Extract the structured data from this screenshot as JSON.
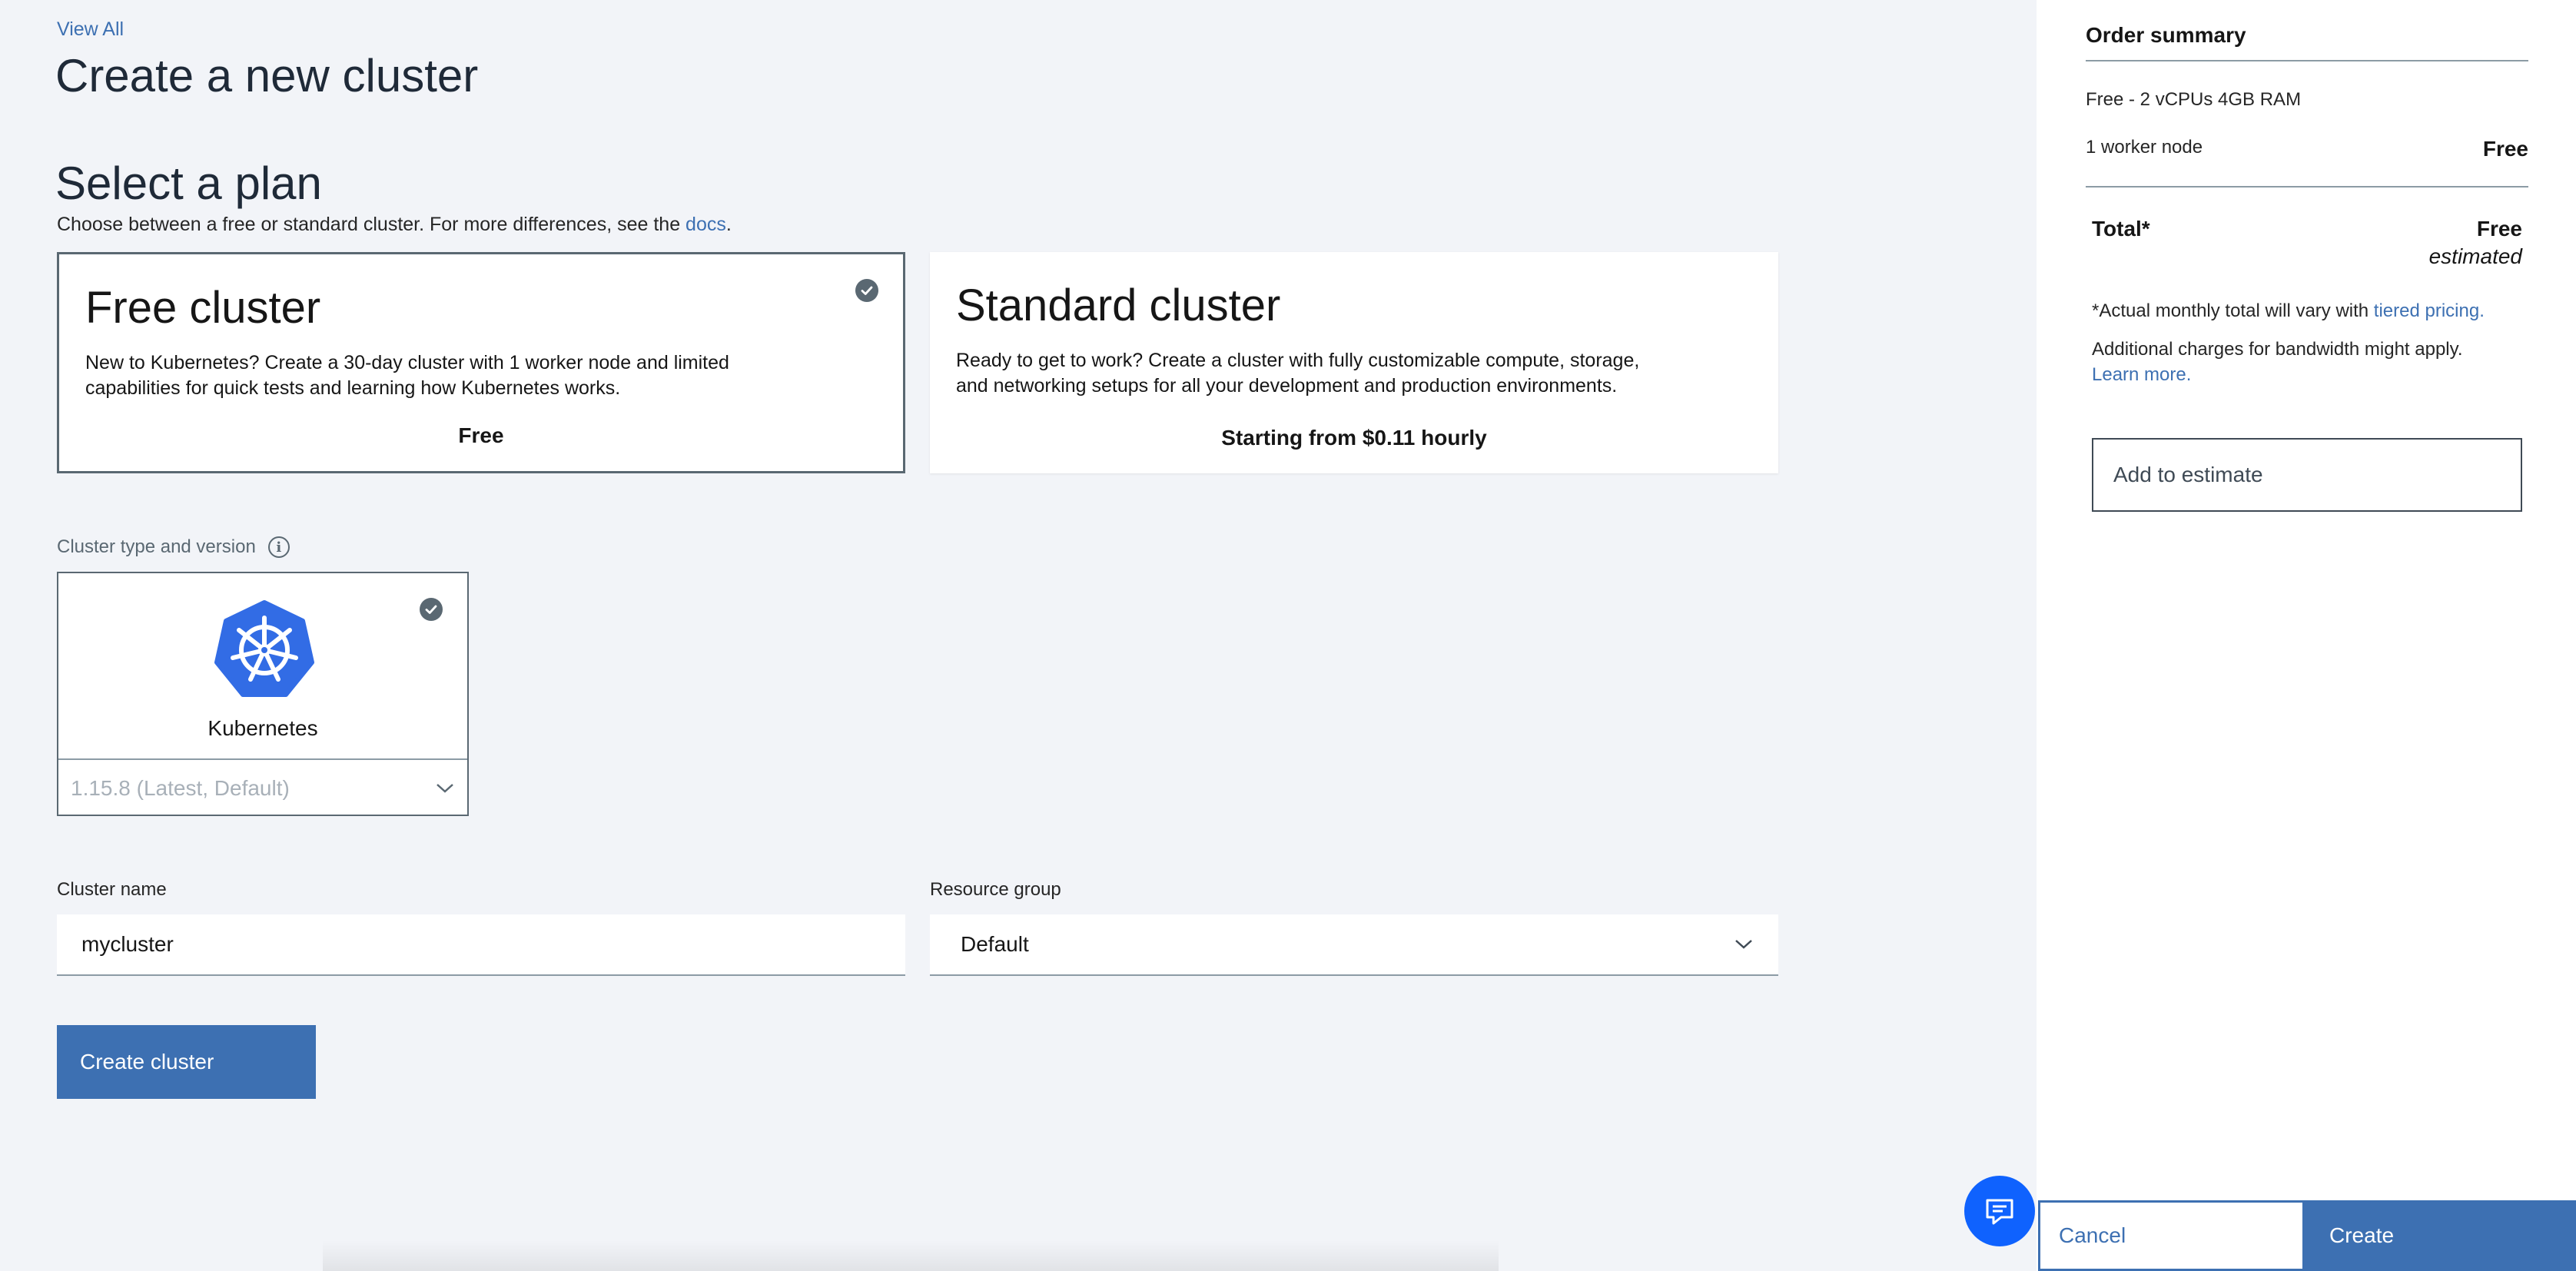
{
  "header": {
    "view_all": "View All",
    "title": "Create a new cluster"
  },
  "plan": {
    "title": "Select a plan",
    "description_prefix": "Choose between a free or standard cluster. For more differences, see the ",
    "description_link": "docs",
    "description_suffix": ".",
    "cards": [
      {
        "name": "Free cluster",
        "text": "New to Kubernetes? Create a 30-day cluster with 1 worker node and limited capabilities for quick tests and learning how Kubernetes works.",
        "price": "Free",
        "selected": true
      },
      {
        "name": "Standard cluster",
        "text": "Ready to get to work? Create a cluster with fully customizable compute, storage, and networking setups for all your development and production environments.",
        "price": "Starting from $0.11 hourly",
        "selected": false
      }
    ]
  },
  "cluster_type": {
    "label": "Cluster type and version",
    "name": "Kubernetes",
    "version": "1.15.8 (Latest, Default)",
    "info_icon": "info-icon",
    "check_icon": "checkmark-icon"
  },
  "form": {
    "cluster_name_label": "Cluster name",
    "cluster_name_value": "mycluster",
    "resource_group_label": "Resource group",
    "resource_group_value": "Default",
    "create_label": "Create cluster"
  },
  "summary": {
    "title": "Order summary",
    "plan_line": "Free - 2 vCPUs 4GB RAM",
    "worker_label": "1 worker node",
    "worker_value": "Free",
    "total_label": "Total*",
    "total_value": "Free",
    "total_note": "estimated",
    "note1_prefix": "*Actual monthly total will vary with ",
    "note1_link": "tiered pricing.",
    "note2": "Additional charges for bandwidth might apply.",
    "note2_link": "Learn more.",
    "estimate_label": "Add to estimate",
    "cancel_label": "Cancel",
    "create_label": "Create"
  },
  "colors": {
    "accent": "#3d70b2",
    "kubernetes": "#326ce5",
    "chat": "#0f62fe",
    "background": "#f2f4f8"
  }
}
